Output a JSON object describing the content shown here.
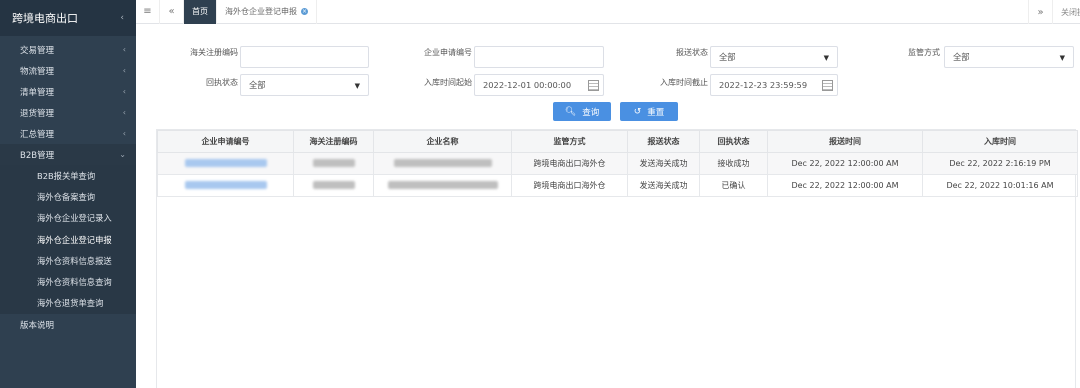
{
  "sidebar": {
    "brand": "跨境电商出口",
    "items": [
      {
        "label": "交易管理"
      },
      {
        "label": "物流管理"
      },
      {
        "label": "清单管理"
      },
      {
        "label": "退货管理"
      },
      {
        "label": "汇总管理"
      },
      {
        "label": "B2B管理"
      }
    ],
    "sub_items": [
      {
        "label": "B2B报关单查询"
      },
      {
        "label": "海外仓备案查询"
      },
      {
        "label": "海外仓企业登记录入"
      },
      {
        "label": "海外仓企业登记申报"
      },
      {
        "label": "海外仓资料信息报送"
      },
      {
        "label": "海外仓资料信息查询"
      },
      {
        "label": "海外仓退货单查询"
      }
    ],
    "footer_item": "版本说明"
  },
  "topbar": {
    "home_tab": "首页",
    "active_tab": "海外仓企业登记申报",
    "close_label": "关闭操作"
  },
  "form": {
    "customs_reg_code_label": "海关注册编码",
    "customs_reg_code_value": "",
    "enterprise_app_no_label": "企业申请编号",
    "enterprise_app_no_value": "",
    "send_status_label": "报送状态",
    "send_status_value": "全部",
    "supervision_label": "监管方式",
    "supervision_value": "全部",
    "receipt_status_label": "回执状态",
    "receipt_status_value": "全部",
    "storage_start_label": "入库时间起始",
    "storage_start_value": "2022-12-01 00:00:00",
    "storage_end_label": "入库时间截止",
    "storage_end_value": "2022-12-23 23:59:59",
    "search_button": "查询",
    "reset_button": "重置"
  },
  "table": {
    "columns": [
      "企业申请编号",
      "海关注册编码",
      "企业名称",
      "监管方式",
      "报送状态",
      "回执状态",
      "报送时间",
      "入库时间"
    ],
    "rows": [
      {
        "supervision": "跨境电商出口海外仓",
        "send_status": "发送海关成功",
        "receipt_status": "接收成功",
        "send_time": "Dec 22, 2022 12:00:00 AM",
        "storage_time": "Dec 22, 2022 2:16:19 PM"
      },
      {
        "supervision": "跨境电商出口海外仓",
        "send_status": "发送海关成功",
        "receipt_status": "已确认",
        "send_time": "Dec 22, 2022 12:00:00 AM",
        "storage_time": "Dec 22, 2022 10:01:16 AM"
      }
    ]
  }
}
